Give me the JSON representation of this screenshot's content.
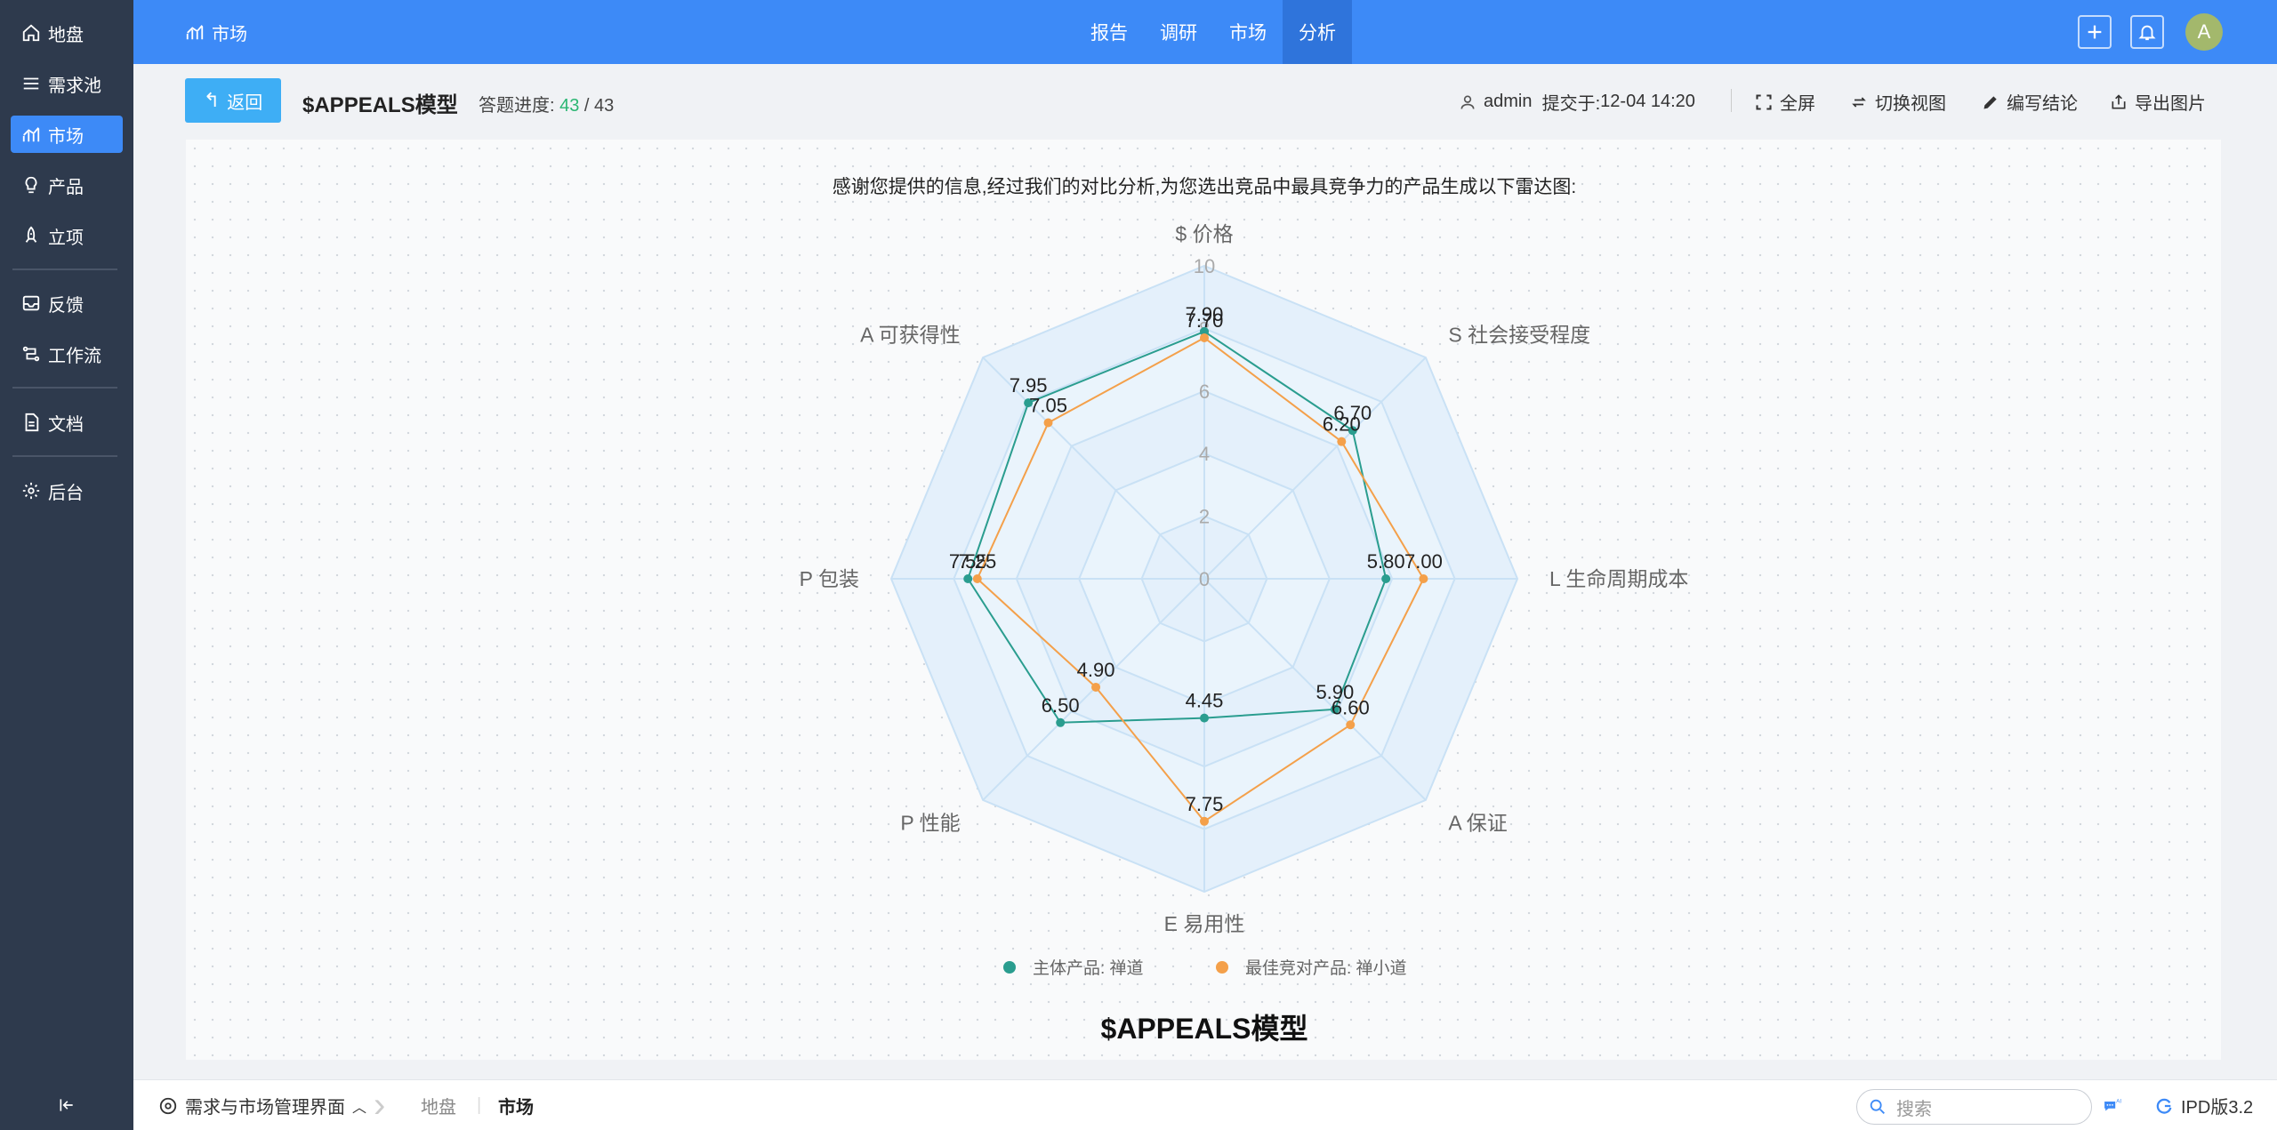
{
  "sidebar": {
    "items": [
      {
        "label": "地盘",
        "icon": "home-icon"
      },
      {
        "label": "需求池",
        "icon": "list-icon"
      },
      {
        "label": "市场",
        "icon": "chart-icon"
      },
      {
        "label": "产品",
        "icon": "bulb-icon"
      },
      {
        "label": "立项",
        "icon": "rocket-icon"
      },
      {
        "label": "反馈",
        "icon": "inbox-icon"
      },
      {
        "label": "工作流",
        "icon": "flow-icon"
      },
      {
        "label": "文档",
        "icon": "doc-icon"
      },
      {
        "label": "后台",
        "icon": "gear-icon"
      }
    ],
    "active_index": 2
  },
  "topbar": {
    "crumb": "市场",
    "nav": [
      "报告",
      "调研",
      "市场",
      "分析"
    ],
    "active_nav": 3,
    "avatar": "A"
  },
  "actions": {
    "back_label": "返回",
    "title": "$APPEALS模型",
    "progress_label": "答题进度:",
    "progress_done": "43",
    "progress_sep": " / ",
    "progress_total": "43",
    "user": "admin",
    "submitted_label": "提交于:",
    "submitted_time": "12-04 14:20",
    "fullscreen": "全屏",
    "switch_view": "切换视图",
    "write_conclusion": "编写结论",
    "export_image": "导出图片"
  },
  "intro_text": "感谢您提供的信息,经过我们的对比分析,为您选出竞品中最具竞争力的产品生成以下雷达图:",
  "chart_data": {
    "type": "radar",
    "title": "$APPEALS模型",
    "axes": [
      "$ 价格",
      "S 社会接受程度",
      "L 生命周期成本",
      "A 保证",
      "E 易用性",
      "P 性能",
      "P 包装",
      "A 可获得性"
    ],
    "r_ticks": [
      "0",
      "2",
      "4",
      "6",
      "8",
      "10"
    ],
    "rlim": [
      0,
      10
    ],
    "legend_position": "bottom",
    "series": [
      {
        "name": "主体产品: 禅道",
        "color": "#2a9d8f",
        "values": [
          7.9,
          6.7,
          5.8,
          5.9,
          4.45,
          6.5,
          7.55,
          7.95
        ],
        "labels": [
          "7.90",
          "6.70",
          "5.80",
          "5.90",
          "4.45",
          "6.50",
          "7.55",
          "7.95"
        ]
      },
      {
        "name": "最佳竞对产品: 禅小道",
        "color": "#f4a04a",
        "values": [
          7.7,
          6.2,
          7.0,
          6.6,
          7.75,
          4.9,
          7.25,
          7.05
        ],
        "labels": [
          "7.70",
          "6.20",
          "7.00",
          "6.60",
          "7.75",
          "4.90",
          "7.25",
          "7.05"
        ]
      }
    ]
  },
  "footer": {
    "workspace": "需求与市场管理界面",
    "crumbs": [
      "地盘",
      "市场"
    ],
    "search_placeholder": "搜索",
    "version": "IPD版3.2"
  }
}
